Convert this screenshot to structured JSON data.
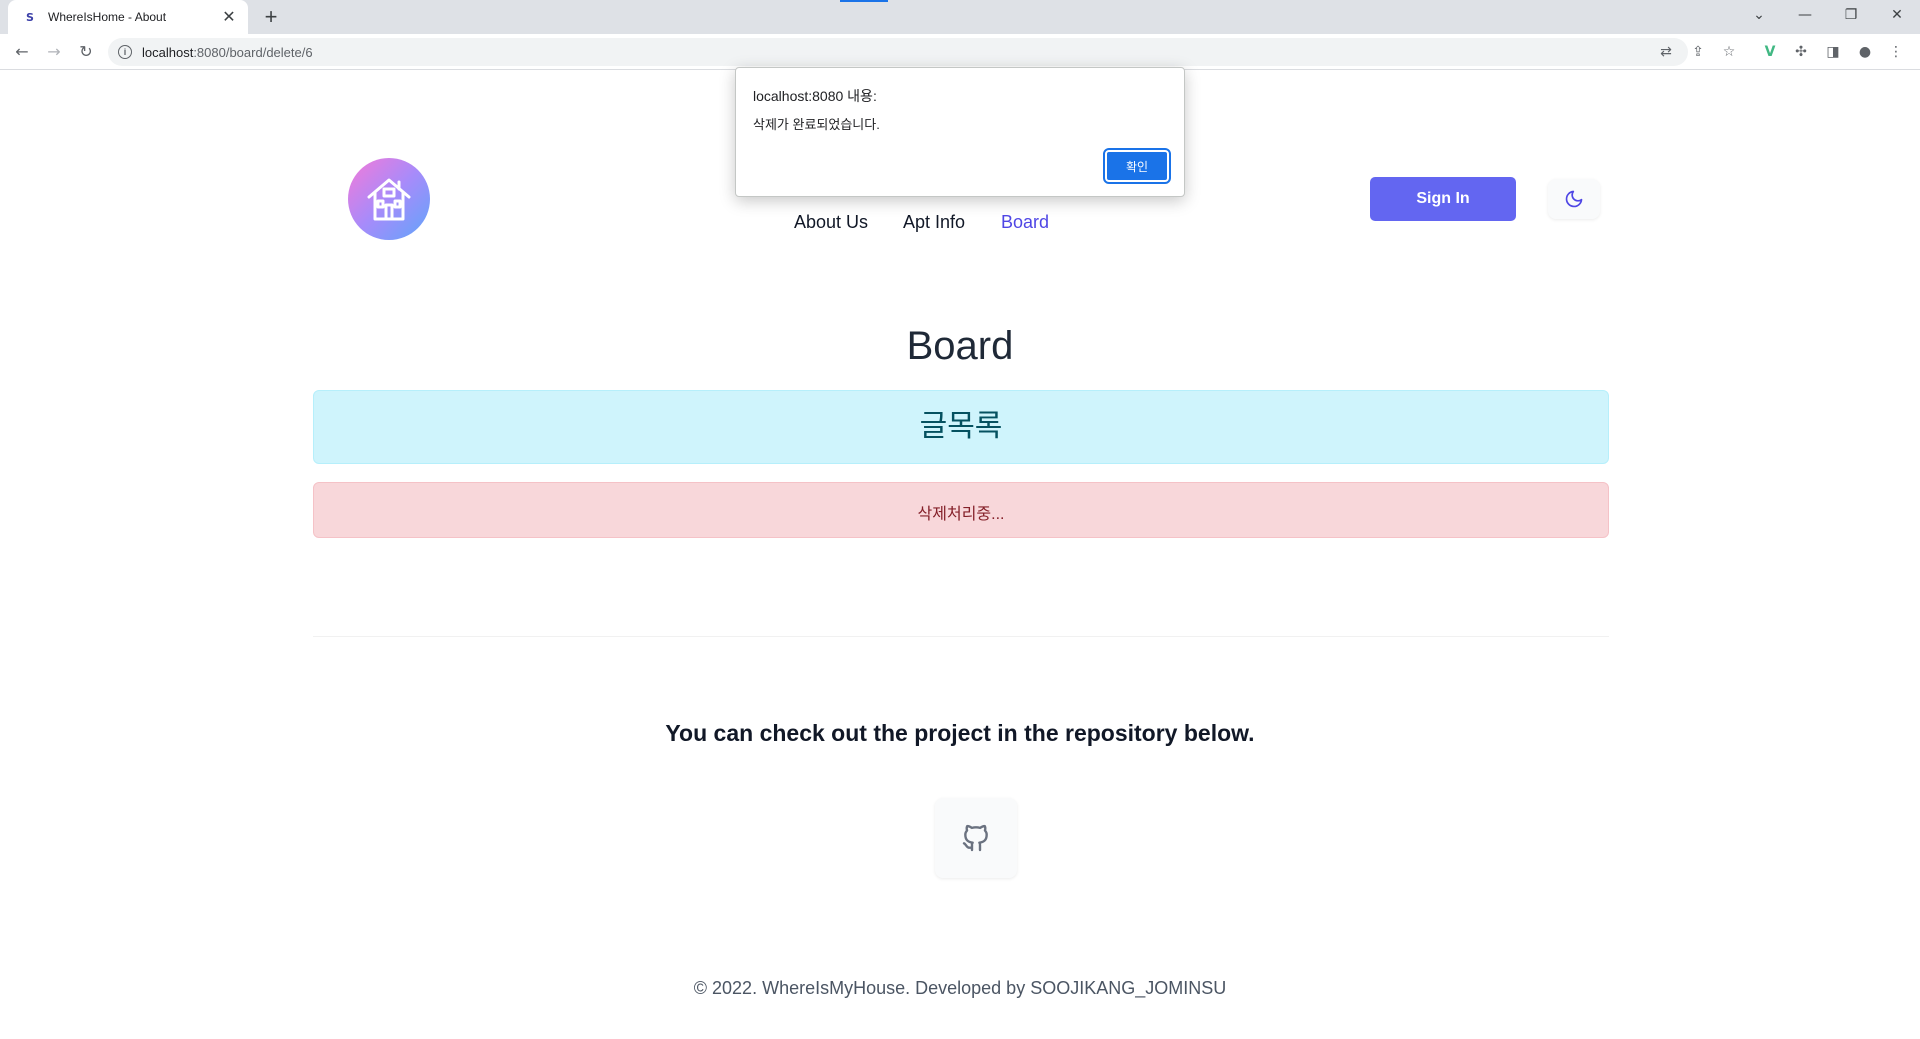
{
  "browser": {
    "tab_title": "WhereIsHome - About",
    "favicon_letter": "S",
    "tab_close": "✕",
    "new_tab": "+",
    "url_host": "localhost",
    "url_rest": ":8080/board/delete/6"
  },
  "header": {
    "nav": [
      {
        "label": "About Us"
      },
      {
        "label": "Apt Info"
      },
      {
        "label": "Board"
      }
    ],
    "sign_in": "Sign In"
  },
  "main": {
    "title": "Board",
    "list_banner": "글목록",
    "status_message": "삭제처리중...",
    "repo_text": "You can check out the project in the repository below."
  },
  "footer": {
    "text": "© 2022. WhereIsMyHouse. Developed by SOOJIKANG_JOMINSU"
  },
  "dialog": {
    "title": "localhost:8080 내용:",
    "message": "삭제가 완료되었습니다.",
    "ok": "확인"
  },
  "colors": {
    "accent": "#6366f1",
    "info_bg": "#cff4fc",
    "danger_bg": "#f8d7da",
    "dialog_button": "#1a73e8"
  }
}
